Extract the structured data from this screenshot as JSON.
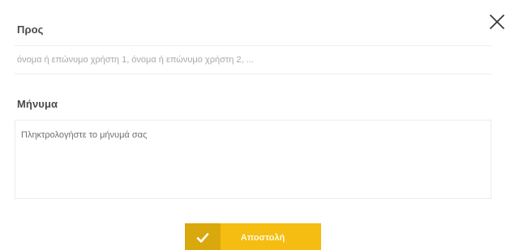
{
  "dialog": {
    "close_icon": "close-icon",
    "to": {
      "label": "Προς",
      "placeholder": "όνομα ή επώνυμο χρήστη 1, όνομα ή επώνυμο χρήστη 2, ..."
    },
    "message": {
      "label": "Μήνυμα",
      "placeholder": "Πληκτρολογήστε το μήνυμά σας"
    },
    "send": {
      "label": "Αποστολή",
      "icon": "checkmark-icon"
    }
  },
  "colors": {
    "accent": "#f5bd12",
    "accent_dark": "#d9a80c",
    "label_text": "#4a4a4a",
    "border": "#ececec"
  }
}
